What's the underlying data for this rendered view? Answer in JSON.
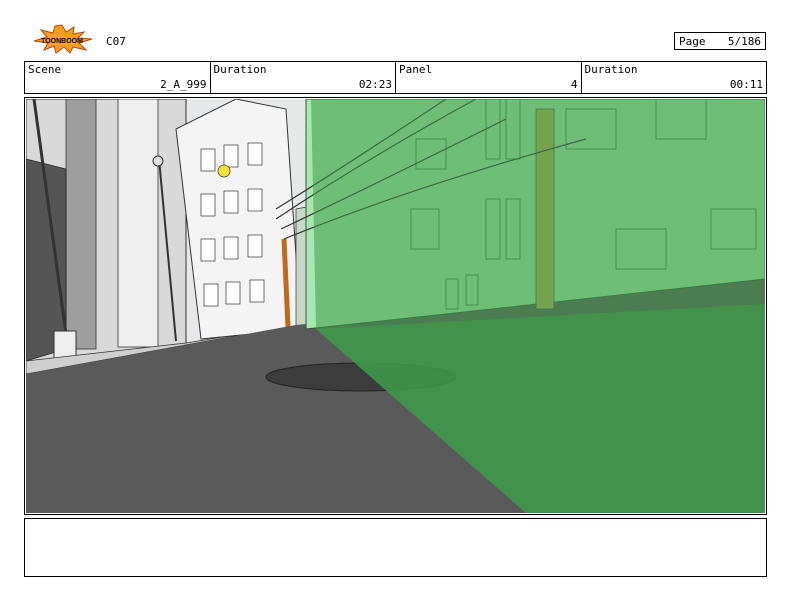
{
  "header": {
    "logo_text": "TOONBOOM",
    "scene_code": "C07",
    "page_label": "Page",
    "page_value": "5/186"
  },
  "info": {
    "scene_label": "Scene",
    "scene_value": "2_A_999",
    "scene_duration_label": "Duration",
    "scene_duration_value": "02:23",
    "panel_label": "Panel",
    "panel_value": "4",
    "panel_duration_label": "Duration",
    "panel_duration_value": "00:11"
  },
  "notes": {
    "text": ""
  },
  "colors": {
    "camera_overlay": "#3f9a4a",
    "street": "#5a5a5a",
    "building_light": "#f2f2f2",
    "building_green": "#a8e8b0"
  }
}
